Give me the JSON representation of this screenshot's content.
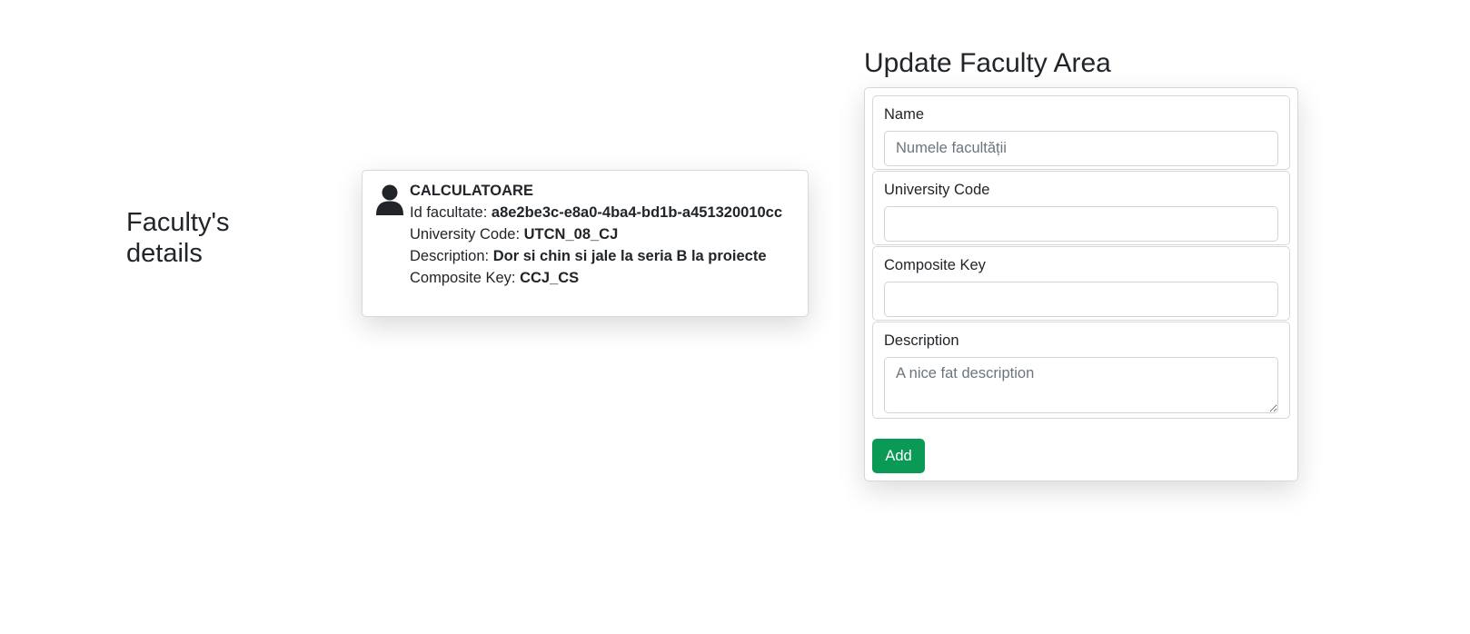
{
  "details": {
    "heading": "Faculty's details"
  },
  "faculty": {
    "name": "CALCULATOARE",
    "id_label": "Id facultate: ",
    "id_value": "a8e2be3c-e8a0-4ba4-bd1b-a451320010cc",
    "code_label": "University Code: ",
    "code_value": "UTCN_08_CJ",
    "description_label": "Description: ",
    "description_value": "Dor si chin si jale la seria B la proiecte",
    "composite_label": "Composite Key: ",
    "composite_value": "CCJ_CS",
    "icon": "person-icon"
  },
  "form": {
    "title": "Update Faculty Area",
    "name_label": "Name",
    "name_placeholder": "Numele facultății",
    "code_label": "University Code",
    "code_value": "",
    "composite_label": "Composite Key",
    "composite_value": "",
    "description_label": "Description",
    "description_placeholder": "A nice fat description",
    "add_label": "Add"
  },
  "colors": {
    "text": "#212529",
    "border": "#d5d8db",
    "success": "#0b9a55",
    "placeholder": "#6c757d"
  }
}
